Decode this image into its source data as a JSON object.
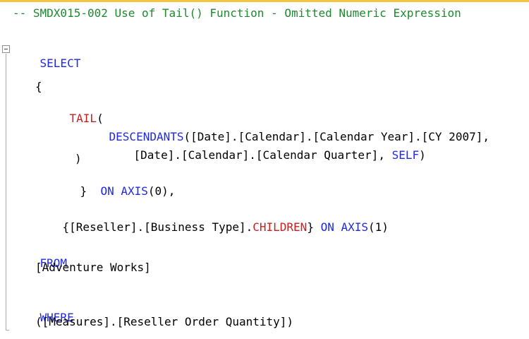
{
  "editor": {
    "comment": "-- SMDX015-002 Use of Tail() Function - Omitted Numeric Expression",
    "select_kw": "SELECT",
    "open_brace": "{",
    "tail_fn": "TAIL",
    "tail_open_paren": "(",
    "descendants_fn": "DESCENDANTS",
    "descendants_args": "([Date].[Calendar].[Calendar Year].[CY 2007],",
    "level_arg": "[Date].[Calendar].[Calendar Quarter], ",
    "self_kw": "SELF",
    "level_close": ")",
    "tail_close_paren": ")",
    "close_brace": "}",
    "on_kw_1": "ON",
    "axis_kw_1": "AXIS",
    "axis0_args": "(0),",
    "reseller_set_open": "{[Reseller].[Business Type].",
    "children_fn": "CHILDREN",
    "reseller_set_close": "} ",
    "on_kw_2": "ON",
    "axis_kw_2": "AXIS",
    "axis1_args": "(1)",
    "from_kw": "FROM",
    "cube": "[Adventure Works]",
    "where_kw": "WHERE",
    "slicer": "([Measures].[Reseller Order Quantity])"
  },
  "colors": {
    "keyword": "#1f28e8",
    "function": "#c81e1e",
    "comment": "#1e8a2f",
    "text": "#000000",
    "top_border": "#f5c542"
  }
}
